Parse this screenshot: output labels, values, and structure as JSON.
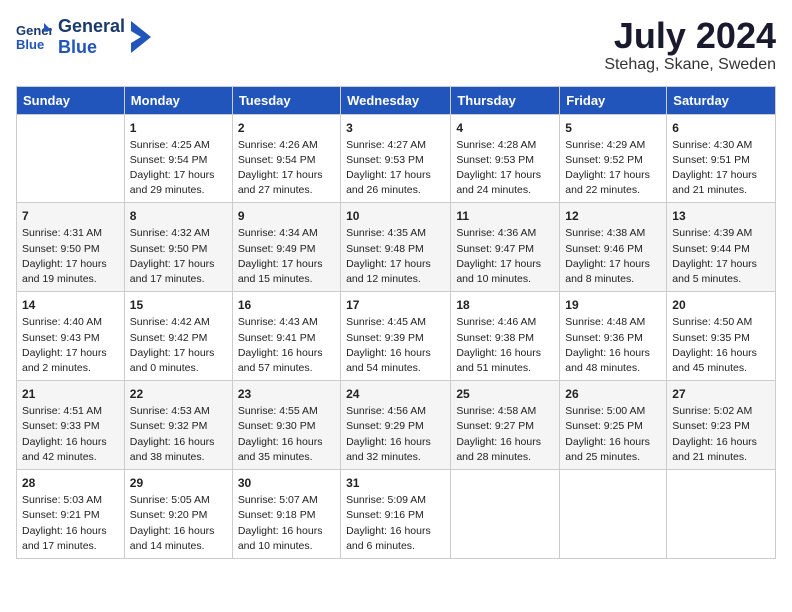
{
  "logo": {
    "line1": "General",
    "line2": "Blue"
  },
  "title": "July 2024",
  "location": "Stehag, Skane, Sweden",
  "days_header": [
    "Sunday",
    "Monday",
    "Tuesday",
    "Wednesday",
    "Thursday",
    "Friday",
    "Saturday"
  ],
  "weeks": [
    [
      {
        "day": "",
        "info": ""
      },
      {
        "day": "1",
        "info": "Sunrise: 4:25 AM\nSunset: 9:54 PM\nDaylight: 17 hours\nand 29 minutes."
      },
      {
        "day": "2",
        "info": "Sunrise: 4:26 AM\nSunset: 9:54 PM\nDaylight: 17 hours\nand 27 minutes."
      },
      {
        "day": "3",
        "info": "Sunrise: 4:27 AM\nSunset: 9:53 PM\nDaylight: 17 hours\nand 26 minutes."
      },
      {
        "day": "4",
        "info": "Sunrise: 4:28 AM\nSunset: 9:53 PM\nDaylight: 17 hours\nand 24 minutes."
      },
      {
        "day": "5",
        "info": "Sunrise: 4:29 AM\nSunset: 9:52 PM\nDaylight: 17 hours\nand 22 minutes."
      },
      {
        "day": "6",
        "info": "Sunrise: 4:30 AM\nSunset: 9:51 PM\nDaylight: 17 hours\nand 21 minutes."
      }
    ],
    [
      {
        "day": "7",
        "info": "Sunrise: 4:31 AM\nSunset: 9:50 PM\nDaylight: 17 hours\nand 19 minutes."
      },
      {
        "day": "8",
        "info": "Sunrise: 4:32 AM\nSunset: 9:50 PM\nDaylight: 17 hours\nand 17 minutes."
      },
      {
        "day": "9",
        "info": "Sunrise: 4:34 AM\nSunset: 9:49 PM\nDaylight: 17 hours\nand 15 minutes."
      },
      {
        "day": "10",
        "info": "Sunrise: 4:35 AM\nSunset: 9:48 PM\nDaylight: 17 hours\nand 12 minutes."
      },
      {
        "day": "11",
        "info": "Sunrise: 4:36 AM\nSunset: 9:47 PM\nDaylight: 17 hours\nand 10 minutes."
      },
      {
        "day": "12",
        "info": "Sunrise: 4:38 AM\nSunset: 9:46 PM\nDaylight: 17 hours\nand 8 minutes."
      },
      {
        "day": "13",
        "info": "Sunrise: 4:39 AM\nSunset: 9:44 PM\nDaylight: 17 hours\nand 5 minutes."
      }
    ],
    [
      {
        "day": "14",
        "info": "Sunrise: 4:40 AM\nSunset: 9:43 PM\nDaylight: 17 hours\nand 2 minutes."
      },
      {
        "day": "15",
        "info": "Sunrise: 4:42 AM\nSunset: 9:42 PM\nDaylight: 17 hours\nand 0 minutes."
      },
      {
        "day": "16",
        "info": "Sunrise: 4:43 AM\nSunset: 9:41 PM\nDaylight: 16 hours\nand 57 minutes."
      },
      {
        "day": "17",
        "info": "Sunrise: 4:45 AM\nSunset: 9:39 PM\nDaylight: 16 hours\nand 54 minutes."
      },
      {
        "day": "18",
        "info": "Sunrise: 4:46 AM\nSunset: 9:38 PM\nDaylight: 16 hours\nand 51 minutes."
      },
      {
        "day": "19",
        "info": "Sunrise: 4:48 AM\nSunset: 9:36 PM\nDaylight: 16 hours\nand 48 minutes."
      },
      {
        "day": "20",
        "info": "Sunrise: 4:50 AM\nSunset: 9:35 PM\nDaylight: 16 hours\nand 45 minutes."
      }
    ],
    [
      {
        "day": "21",
        "info": "Sunrise: 4:51 AM\nSunset: 9:33 PM\nDaylight: 16 hours\nand 42 minutes."
      },
      {
        "day": "22",
        "info": "Sunrise: 4:53 AM\nSunset: 9:32 PM\nDaylight: 16 hours\nand 38 minutes."
      },
      {
        "day": "23",
        "info": "Sunrise: 4:55 AM\nSunset: 9:30 PM\nDaylight: 16 hours\nand 35 minutes."
      },
      {
        "day": "24",
        "info": "Sunrise: 4:56 AM\nSunset: 9:29 PM\nDaylight: 16 hours\nand 32 minutes."
      },
      {
        "day": "25",
        "info": "Sunrise: 4:58 AM\nSunset: 9:27 PM\nDaylight: 16 hours\nand 28 minutes."
      },
      {
        "day": "26",
        "info": "Sunrise: 5:00 AM\nSunset: 9:25 PM\nDaylight: 16 hours\nand 25 minutes."
      },
      {
        "day": "27",
        "info": "Sunrise: 5:02 AM\nSunset: 9:23 PM\nDaylight: 16 hours\nand 21 minutes."
      }
    ],
    [
      {
        "day": "28",
        "info": "Sunrise: 5:03 AM\nSunset: 9:21 PM\nDaylight: 16 hours\nand 17 minutes."
      },
      {
        "day": "29",
        "info": "Sunrise: 5:05 AM\nSunset: 9:20 PM\nDaylight: 16 hours\nand 14 minutes."
      },
      {
        "day": "30",
        "info": "Sunrise: 5:07 AM\nSunset: 9:18 PM\nDaylight: 16 hours\nand 10 minutes."
      },
      {
        "day": "31",
        "info": "Sunrise: 5:09 AM\nSunset: 9:16 PM\nDaylight: 16 hours\nand 6 minutes."
      },
      {
        "day": "",
        "info": ""
      },
      {
        "day": "",
        "info": ""
      },
      {
        "day": "",
        "info": ""
      }
    ]
  ]
}
